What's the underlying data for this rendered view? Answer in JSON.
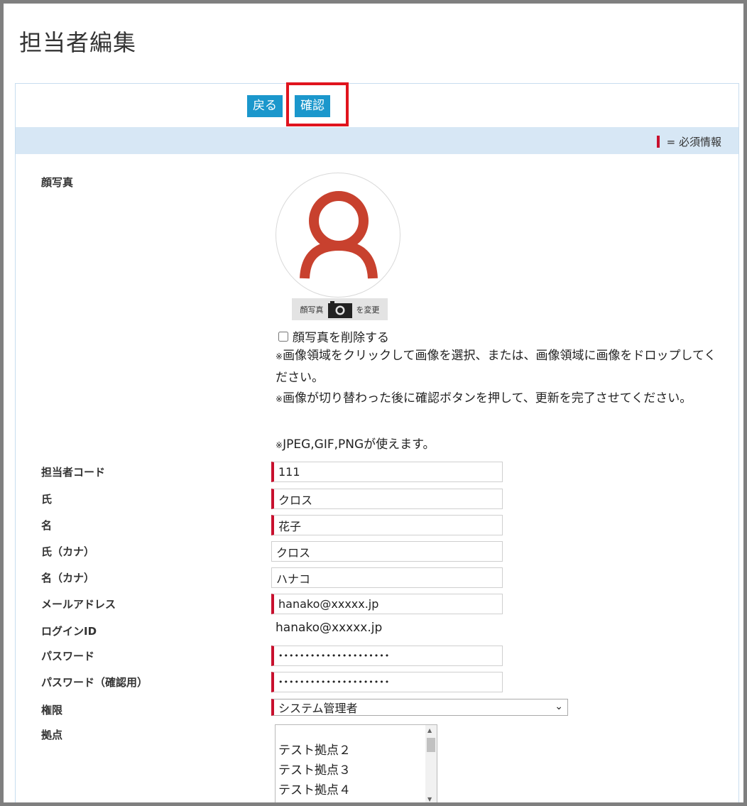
{
  "page": {
    "title": "担当者編集"
  },
  "toolbar": {
    "back_label": "戻る",
    "confirm_label": "確認"
  },
  "required_legend": "= 必須情報",
  "photo": {
    "label": "顔写真",
    "change_left": "顔写真",
    "change_right": "を変更",
    "delete_label": "顔写真を削除する",
    "delete_checked": false,
    "notes": [
      "画像領域をクリックして画像を選択、または、画像領域に画像をドロップしてください。",
      "画像が切り替わった後に確認ボタンを押して、更新を完了させてください。",
      "JPEG,GIF,PNGが使えます。"
    ],
    "note_mark": "※"
  },
  "fields": {
    "code": {
      "label": "担当者コード",
      "value": "111"
    },
    "last_name": {
      "label": "氏",
      "value": "クロス"
    },
    "first_name": {
      "label": "名",
      "value": "花子"
    },
    "last_kana": {
      "label": "氏（カナ）",
      "value": "クロス"
    },
    "first_kana": {
      "label": "名（カナ）",
      "value": "ハナコ"
    },
    "email": {
      "label": "メールアドレス",
      "value": "hanako@xxxxx.jp"
    },
    "login_id": {
      "label": "ログインID",
      "value": "hanako@xxxxx.jp"
    },
    "password": {
      "label": "パスワード",
      "value": "•••••••••••••••••••••"
    },
    "password_confirm": {
      "label": "パスワード（確認用）",
      "value": "•••••••••••••••••••••"
    },
    "role": {
      "label": "権限",
      "value": "システム管理者"
    },
    "bases": {
      "label": "拠点",
      "items": [
        "テスト拠点２",
        "テスト拠点３",
        "テスト拠点４"
      ]
    }
  },
  "colors": {
    "accent": "#1b97cc",
    "required": "#c8102e",
    "highlight": "#e0141e",
    "avatar": "#c8412e"
  }
}
